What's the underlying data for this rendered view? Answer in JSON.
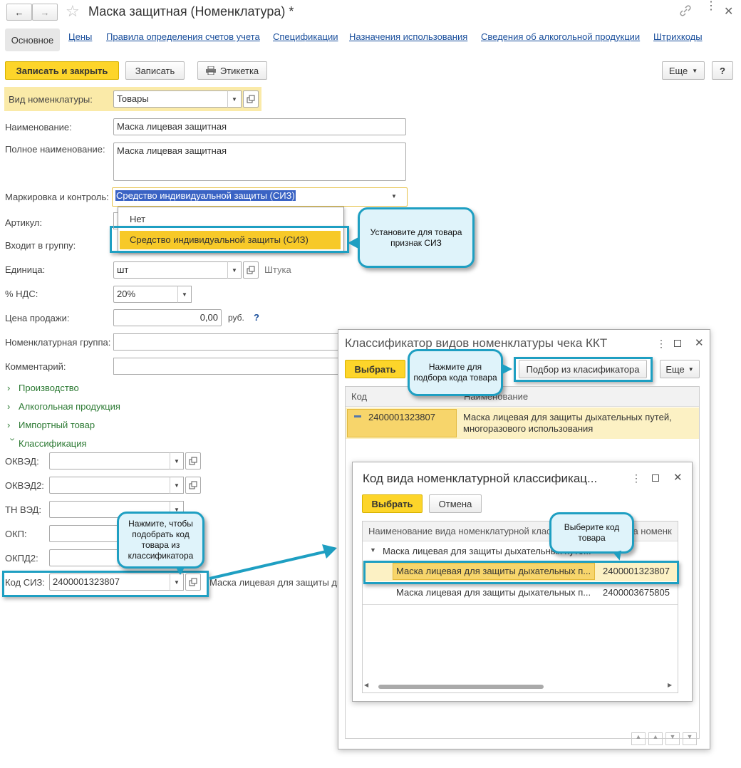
{
  "window": {
    "title": "Маска защитная (Номенклатура) *"
  },
  "tabs": [
    {
      "label": "Основное"
    },
    {
      "label": "Цены"
    },
    {
      "label": "Правила определения счетов учета"
    },
    {
      "label": "Спецификации"
    },
    {
      "label": "Назначения использования"
    },
    {
      "label": "Сведения об алкогольной продукции"
    },
    {
      "label": "Штрихкоды"
    }
  ],
  "toolbar": {
    "save_close": "Записать и закрыть",
    "save": "Записать",
    "label": "Этикетка",
    "more": "Еще",
    "help": "?"
  },
  "form": {
    "kind_label": "Вид номенклатуры:",
    "kind_value": "Товары",
    "name_label": "Наименование:",
    "name_value": "Маска лицевая защитная",
    "fullname_label": "Полное наименование:",
    "fullname_value": "Маска лицевая защитная",
    "marking_label": "Маркировка и контроль:",
    "marking_value": "Средство индивидуальной защиты (СИЗ)",
    "article_label": "Артикул:",
    "group_label": "Входит в группу:",
    "unit_label": "Единица:",
    "unit_value": "шт",
    "unit_hint": "Штука",
    "vat_label": "% НДС:",
    "vat_value": "20%",
    "price_label": "Цена продажи:",
    "price_value": "0,00",
    "price_currency": "руб.",
    "price_help": "?",
    "nomgroup_label": "Номенклатурная группа:",
    "comment_label": "Комментарий:"
  },
  "dropdown": {
    "options": [
      "Нет",
      "Средство индивидуальной защиты (СИЗ)"
    ],
    "selected_index": 1
  },
  "sections": {
    "production": "Производство",
    "alcohol": "Алкогольная продукция",
    "import": "Импортный товар",
    "classification": "Классификация"
  },
  "classification": {
    "okved_label": "ОКВЭД:",
    "okved2_label": "ОКВЭД2:",
    "tnved_label": "ТН ВЭД:",
    "okp_label": "ОКП:",
    "okpd2_label": "ОКПД2:",
    "siz_label": "Код СИЗ:",
    "siz_value": "2400001323807",
    "siz_desc": "Маска лицевая для защиты ды"
  },
  "callouts": {
    "set_siz": "Установите для товара признак СИЗ",
    "pick_code": "Нажмите, чтобы подобрать код товара из классификатора",
    "pick_from_classifier": "Нажмите для подбора кода товара",
    "choose_code": "Выберите код товара"
  },
  "classifier_dialog": {
    "title": "Классификатор видов номенклатуры чека ККТ",
    "select": "Выбрать",
    "pick": "Подбор из класификатора",
    "more": "Еще",
    "col_code": "Код",
    "col_name": "Наименование",
    "row_code": "2400001323807",
    "row_name": "Маска лицевая для защиты дыхательных путей, многоразового использования"
  },
  "code_dialog": {
    "title": "Код вида номенклатурной классификац...",
    "select": "Выбрать",
    "cancel": "Отмена",
    "col_name": "Наименование вида номенклатурной клас",
    "col_code": "Код вида номенк",
    "group_name": "Маска лицевая для защиты дыхательных путе...",
    "rows": [
      {
        "name": "Маска лицевая для защиты дыхательных п...",
        "code": "2400001323807"
      },
      {
        "name": "Маска лицевая для защиты дыхательных п...",
        "code": "2400003675805"
      }
    ]
  },
  "colors": {
    "accent": "#1e9fc2",
    "yellow": "#fdd52a",
    "link": "#1a4f9c",
    "section": "#2c7a33"
  }
}
